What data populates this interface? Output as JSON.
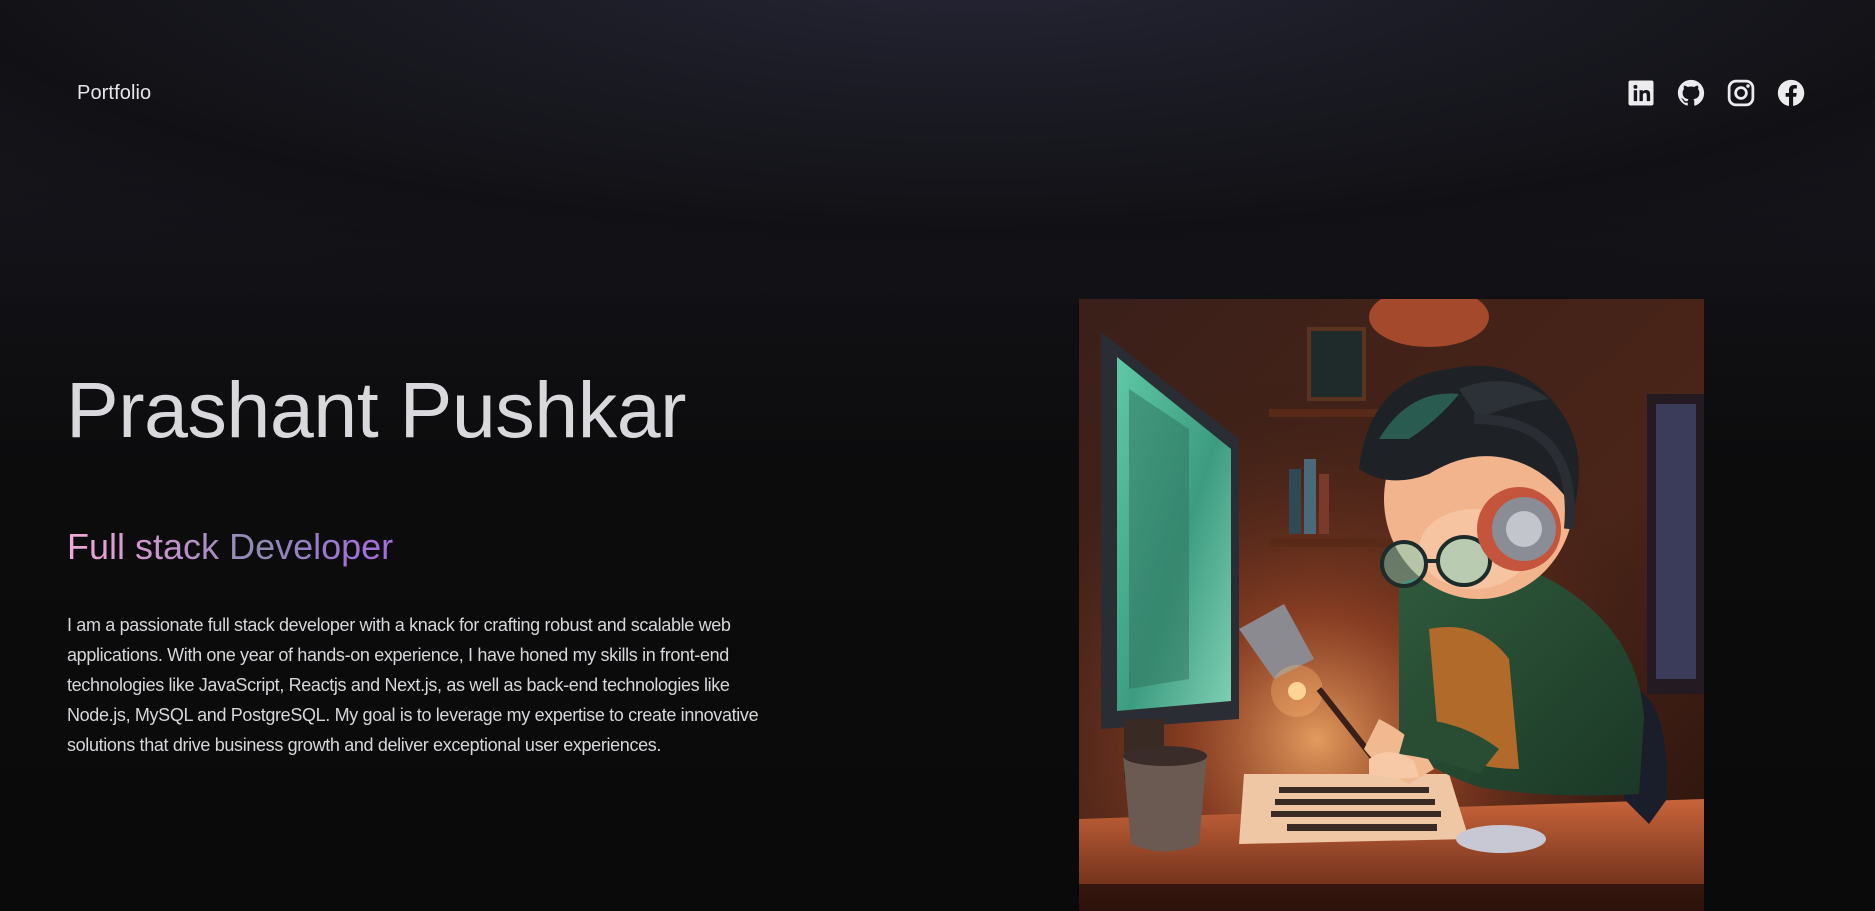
{
  "nav": {
    "brand": "Portfolio",
    "socials": [
      {
        "name": "LinkedIn",
        "icon": "linkedin-icon"
      },
      {
        "name": "GitHub",
        "icon": "github-icon"
      },
      {
        "name": "Instagram",
        "icon": "instagram-icon"
      },
      {
        "name": "Facebook",
        "icon": "facebook-icon"
      }
    ]
  },
  "hero": {
    "name": "Prashant Pushkar",
    "role_words": [
      "Full",
      "stack",
      "Developer"
    ],
    "bio": "I am a passionate full stack developer with a knack for crafting robust and scalable web applications. With one year of hands-on experience, I have honed my skills in front-end technologies like JavaScript, Reactjs and Next.js, as well as back-end technologies like Node.js, MySQL and PostgreSQL. My goal is to leverage my expertise to create innovative solutions that drive business growth and deliver exceptional user experiences.",
    "illustration": "developer-at-computer-illustration"
  },
  "colors": {
    "background": "#0b0b0c",
    "text": "#d9d9dd",
    "gradient_start": "#f2a9d6",
    "gradient_end": "#a66be0"
  }
}
